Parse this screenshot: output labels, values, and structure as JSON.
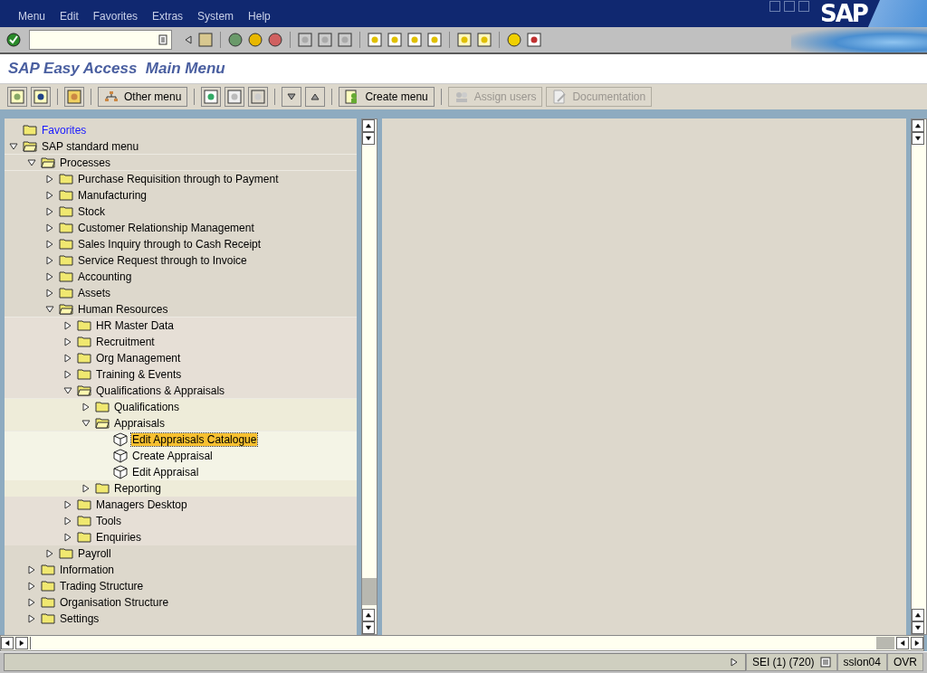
{
  "menu_bar": [
    "Menu",
    "Edit",
    "Favorites",
    "Extras",
    "System",
    "Help"
  ],
  "logo": "SAP",
  "title": "SAP Easy Access  Main Menu",
  "app_toolbar": [
    {
      "label": "Other menu",
      "disabled": false
    },
    {
      "label": "Create menu",
      "disabled": false
    },
    {
      "label": "Assign users",
      "disabled": true
    },
    {
      "label": "Documentation",
      "disabled": true
    }
  ],
  "tree": {
    "favorites": "Favorites",
    "root": {
      "label": "SAP standard menu",
      "kind": "folder",
      "expanded": true,
      "children": [
        {
          "label": "Processes",
          "kind": "folder",
          "expanded": true,
          "children": [
            {
              "label": "Purchase Requisition through to Payment",
              "kind": "folder",
              "expanded": false
            },
            {
              "label": "Manufacturing",
              "kind": "folder",
              "expanded": false
            },
            {
              "label": "Stock",
              "kind": "folder",
              "expanded": false
            },
            {
              "label": "Customer Relationship Management",
              "kind": "folder",
              "expanded": false
            },
            {
              "label": "Sales Inquiry through to Cash Receipt",
              "kind": "folder",
              "expanded": false
            },
            {
              "label": "Service Request through to Invoice",
              "kind": "folder",
              "expanded": false
            },
            {
              "label": "Accounting",
              "kind": "folder",
              "expanded": false
            },
            {
              "label": "Assets",
              "kind": "folder",
              "expanded": false
            },
            {
              "label": "Human Resources",
              "kind": "folder",
              "expanded": true,
              "children": [
                {
                  "label": "HR Master Data",
                  "kind": "folder",
                  "expanded": false
                },
                {
                  "label": "Recruitment",
                  "kind": "folder",
                  "expanded": false
                },
                {
                  "label": "Org Management",
                  "kind": "folder",
                  "expanded": false
                },
                {
                  "label": "Training & Events",
                  "kind": "folder",
                  "expanded": false
                },
                {
                  "label": "Qualifications & Appraisals",
                  "kind": "folder",
                  "expanded": true,
                  "children": [
                    {
                      "label": "Qualifications",
                      "kind": "folder",
                      "expanded": false
                    },
                    {
                      "label": "Appraisals",
                      "kind": "folder",
                      "expanded": true,
                      "children": [
                        {
                          "label": "Edit Appraisals Catalogue",
                          "kind": "transaction",
                          "selected": true
                        },
                        {
                          "label": "Create Appraisal",
                          "kind": "transaction",
                          "selected": false
                        },
                        {
                          "label": "Edit Appraisal",
                          "kind": "transaction",
                          "selected": false
                        }
                      ]
                    },
                    {
                      "label": "Reporting",
                      "kind": "folder",
                      "expanded": false
                    }
                  ]
                },
                {
                  "label": "Managers Desktop",
                  "kind": "folder",
                  "expanded": false
                },
                {
                  "label": "Tools",
                  "kind": "folder",
                  "expanded": false
                },
                {
                  "label": "Enquiries",
                  "kind": "folder",
                  "expanded": false
                }
              ]
            },
            {
              "label": "Payroll",
              "kind": "folder",
              "expanded": false
            }
          ]
        },
        {
          "label": "Information",
          "kind": "folder",
          "expanded": false
        },
        {
          "label": "Trading Structure",
          "kind": "folder",
          "expanded": false
        },
        {
          "label": "Organisation Structure",
          "kind": "folder",
          "expanded": false
        },
        {
          "label": "Settings",
          "kind": "folder",
          "expanded": false
        }
      ]
    }
  },
  "status_bar": {
    "system": "SEI (1) (720)",
    "server": "sslon04",
    "mode": "OVR"
  }
}
